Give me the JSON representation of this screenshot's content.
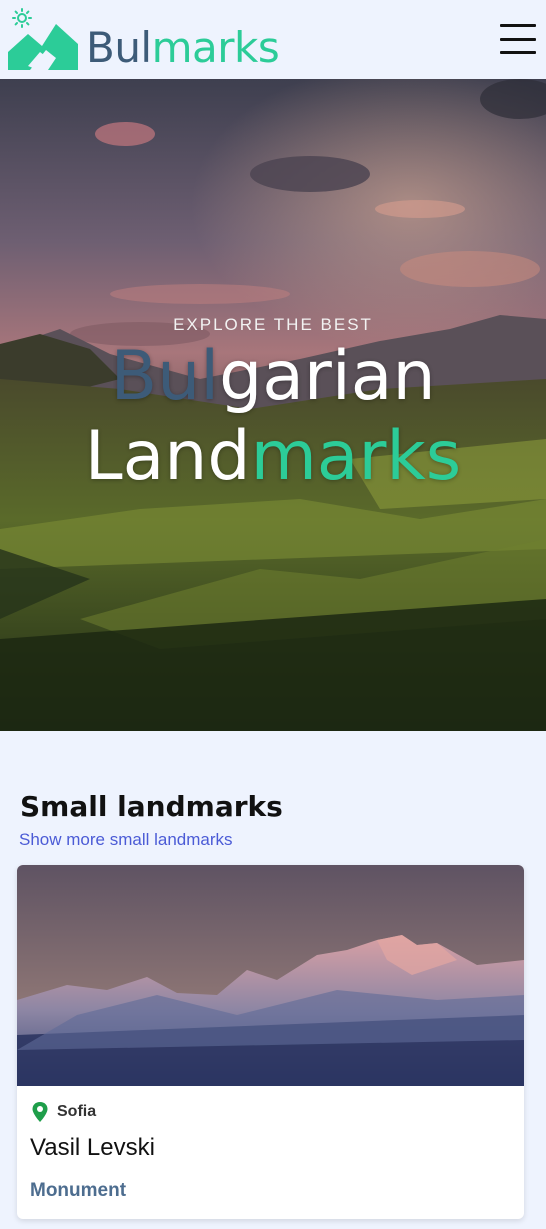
{
  "header": {
    "brand_part1": "Bul",
    "brand_part2": "marks",
    "theme_icon": "sun-icon",
    "menu_icon": "hamburger-menu-icon"
  },
  "hero": {
    "kicker": "EXPLORE THE BEST",
    "line1_part1": "Bul",
    "line1_part2": "garian",
    "line2_part1": "Land",
    "line2_part2": "marks"
  },
  "section": {
    "title": "Small landmarks",
    "link": "Show more small landmarks"
  },
  "cards": [
    {
      "location": "Sofia",
      "title": "Vasil Levski",
      "category": "Monument",
      "location_icon": "map-pin-icon"
    }
  ],
  "colors": {
    "background": "#eef3fe",
    "brand_dark": "#3d5b78",
    "brand_accent": "#2ccc98",
    "link": "#4b5bd6",
    "pin": "#1e9e4a"
  }
}
